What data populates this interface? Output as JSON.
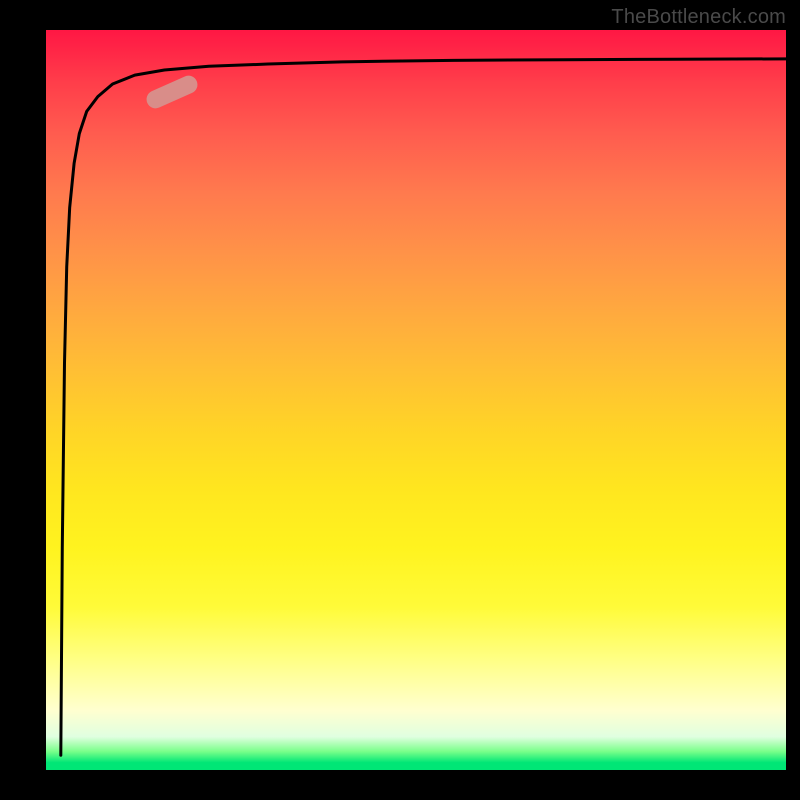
{
  "credit": "TheBottleneck.com",
  "colors": {
    "frame": "#000000",
    "gradient_top": "#ff1744",
    "gradient_mid": "#ffe61f",
    "gradient_bottom": "#00e676",
    "curve": "#000000",
    "marker": "#d98d89",
    "credit_text": "#4a4a4a"
  },
  "chart_data": {
    "type": "line",
    "title": "",
    "xlabel": "",
    "ylabel": "",
    "xlim": [
      0,
      100
    ],
    "ylim": [
      0,
      100
    ],
    "grid": false,
    "legend": false,
    "series": [
      {
        "name": "curve",
        "x": [
          2.0,
          2.2,
          2.5,
          2.8,
          3.2,
          3.8,
          4.5,
          5.5,
          7.0,
          9.0,
          12.0,
          16.0,
          22.0,
          30.0,
          40.0,
          55.0,
          70.0,
          85.0,
          100.0
        ],
        "y": [
          2.0,
          30.0,
          55.0,
          68.0,
          76.0,
          82.0,
          86.0,
          89.0,
          91.0,
          92.7,
          93.9,
          94.6,
          95.1,
          95.4,
          95.7,
          95.9,
          95.98,
          96.05,
          96.1
        ]
      }
    ],
    "marker": {
      "x": 17.0,
      "y": 91.6,
      "angle_deg": -24
    }
  }
}
